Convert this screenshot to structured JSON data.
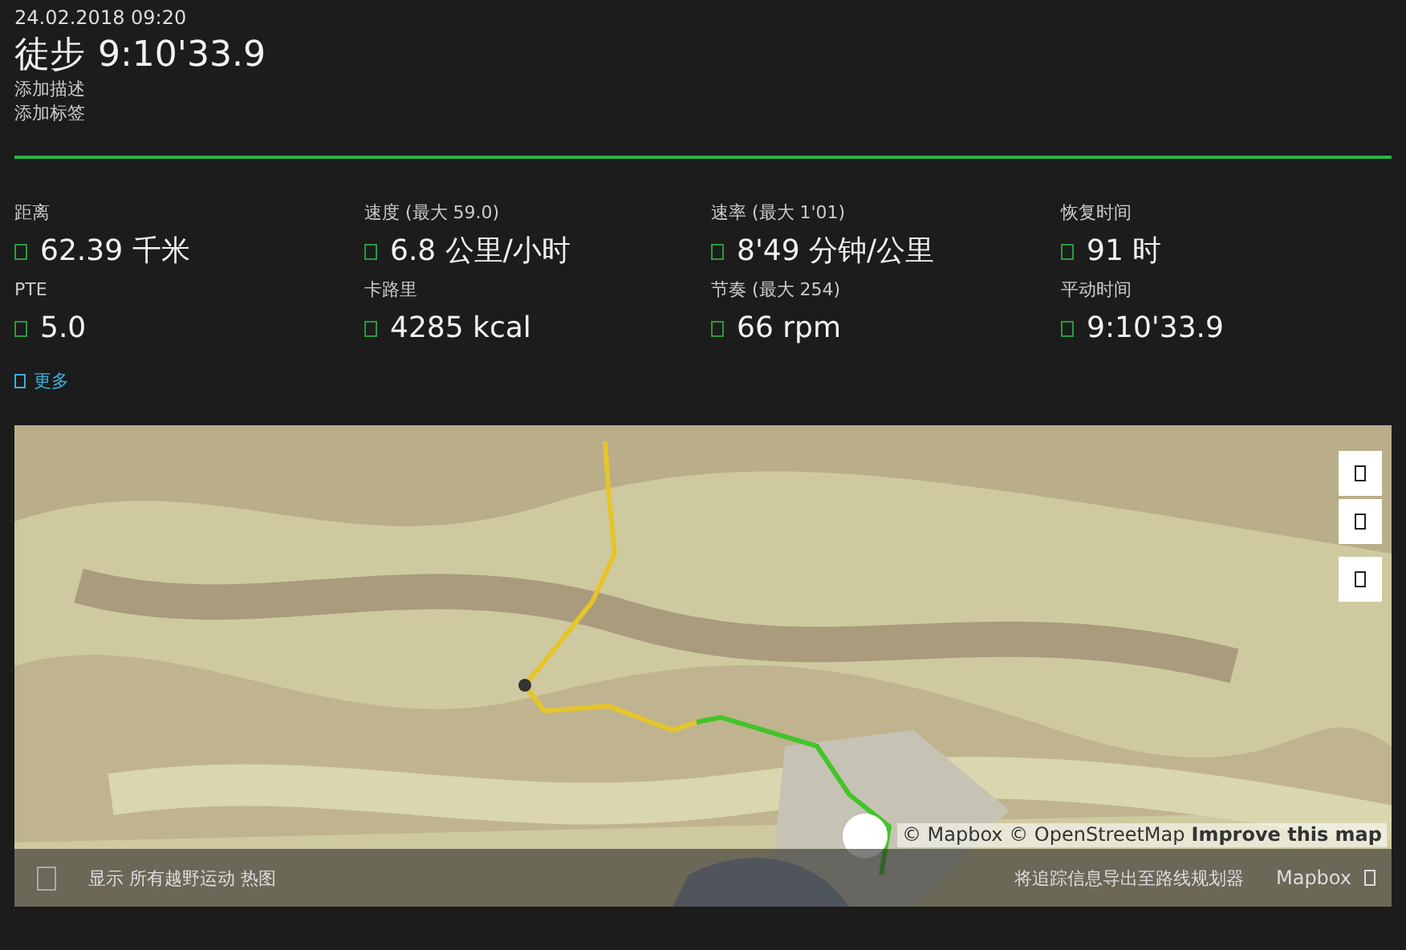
{
  "header": {
    "date": "24.02.2018 09:20",
    "activity": "徒步",
    "duration": "9:10'33.9",
    "links": [
      "添加描述",
      "添加标签"
    ]
  },
  "stats": [
    {
      "label": "距离",
      "value": "62.39 千米"
    },
    {
      "label": "速度 (最大 59.0)",
      "value": "6.8 公里/小时"
    },
    {
      "label": "速率 (最大 1'01)",
      "value": "8'49 分钟/公里"
    },
    {
      "label": "恢复时间",
      "value": "91 时"
    },
    {
      "label": "PTE",
      "value": "5.0"
    },
    {
      "label": "卡路里",
      "value": "4285 kcal"
    },
    {
      "label": "节奏 (最大 254)",
      "value": "66 rpm"
    },
    {
      "label": "平动时间",
      "value": "9:10'33.9"
    }
  ],
  "more_link": "更多",
  "map": {
    "kind": "picture",
    "controls": [
      {
        "kind": "zoom-in"
      },
      {
        "kind": "zoom-out"
      },
      {
        "kind": "layers"
      }
    ],
    "attribution": [
      "© Mapbox © OpenStreetMap",
      "Improve this map"
    ],
    "heatmap": {
      "checked": false,
      "label": "显示 所有越野运动 热图"
    },
    "export_link": "将追踪信息导出至路线规划器",
    "provider": "Mapbox"
  }
}
